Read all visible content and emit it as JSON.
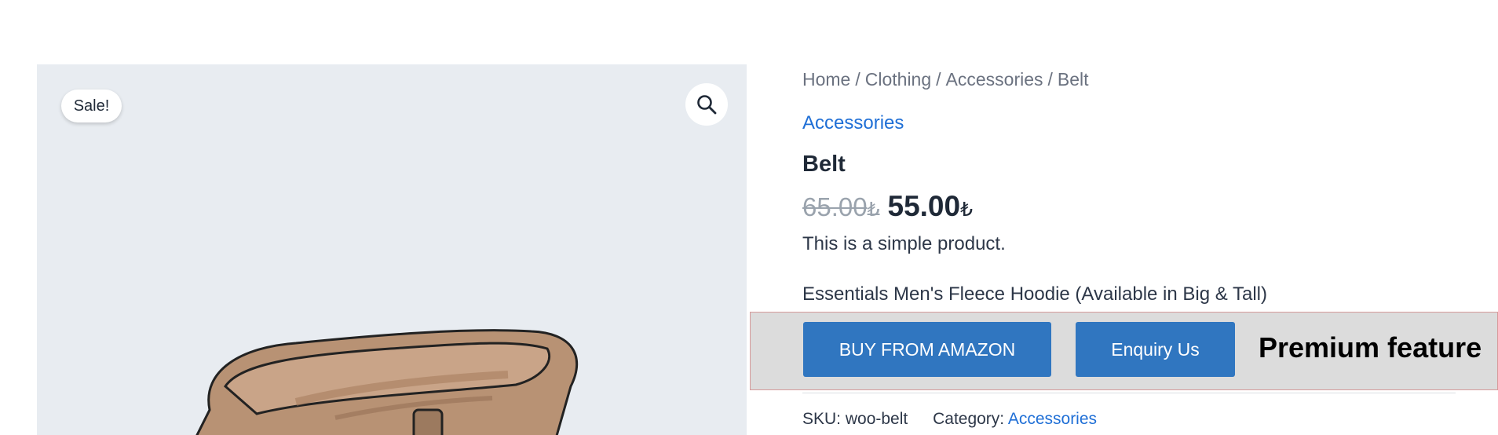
{
  "gallery": {
    "sale_badge": "Sale!",
    "zoom_icon": "magnifier-icon",
    "image_subject": "belt"
  },
  "breadcrumb": {
    "items": [
      "Home",
      "Clothing",
      "Accessories",
      "Belt"
    ],
    "separator": "/"
  },
  "product": {
    "category_link": "Accessories",
    "title": "Belt",
    "price_old": "65.00",
    "price_new": "55.00",
    "currency_symbol": "₺",
    "short_description": "This is a simple product.",
    "external_title": "Essentials Men's Fleece Hoodie (Available in Big & Tall)"
  },
  "actions": {
    "buy_label": "BUY FROM AMAZON",
    "enquiry_label": "Enquiry Us",
    "premium_label": "Premium feature"
  },
  "meta": {
    "sku_label": "SKU:",
    "sku_value": "woo-belt",
    "category_label": "Category:",
    "category_value": "Accessories"
  },
  "colors": {
    "accent_blue": "#3076c0",
    "link_blue": "#1f6fd6",
    "gallery_bg": "#e8ecf1"
  }
}
